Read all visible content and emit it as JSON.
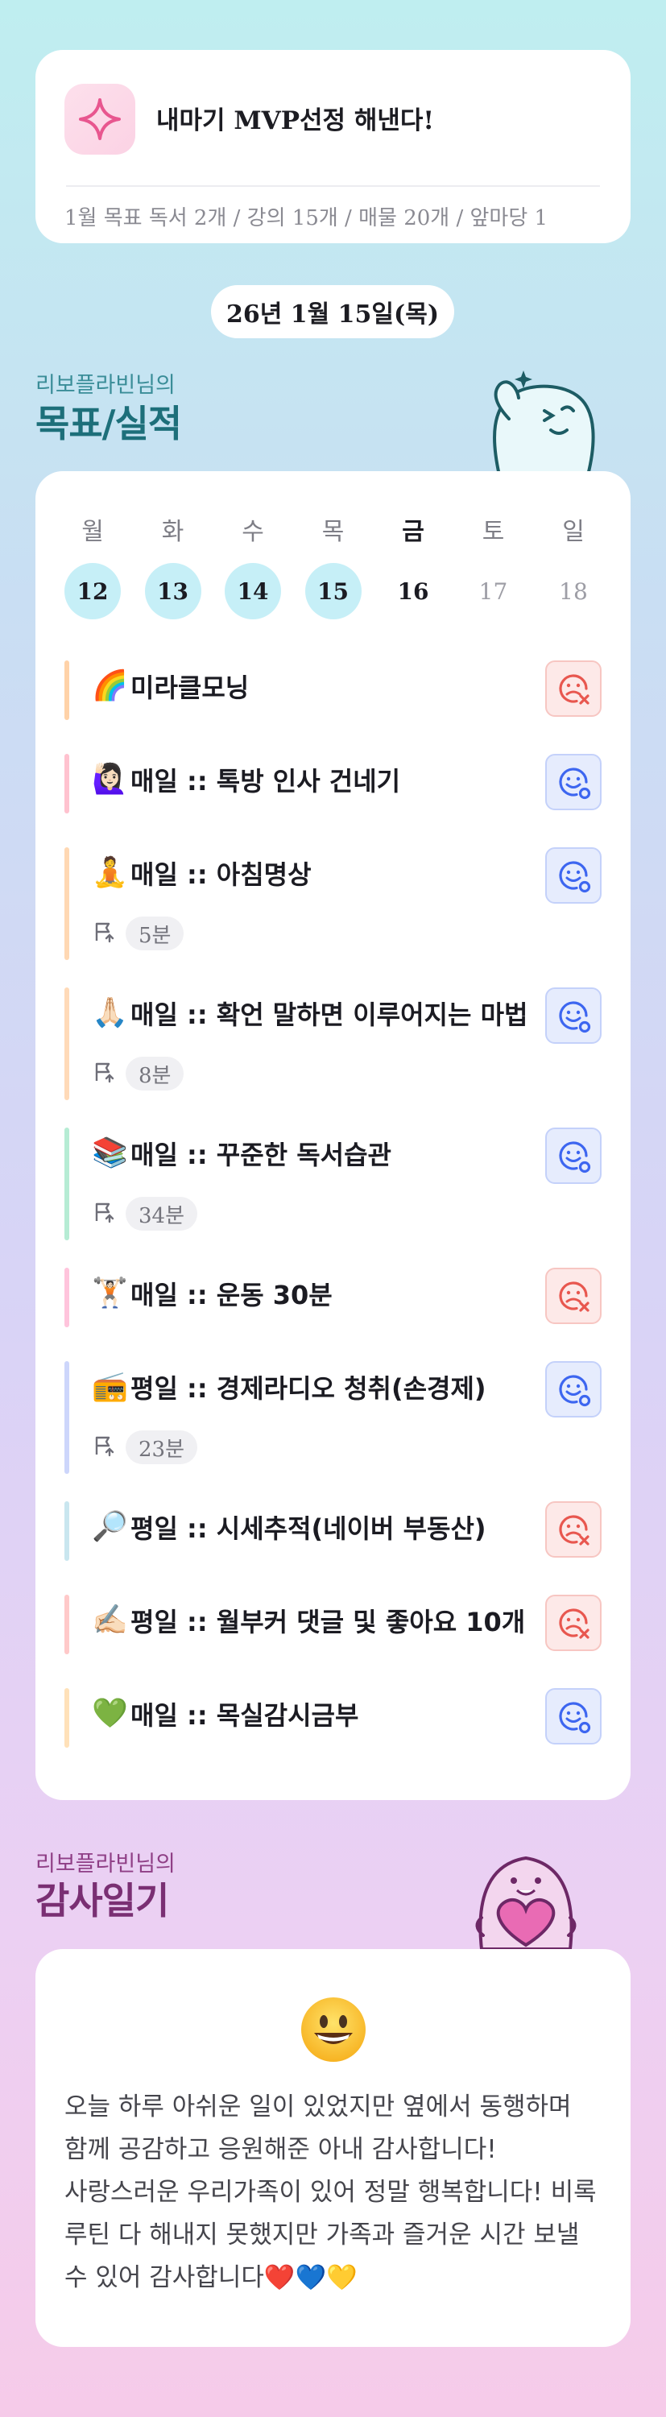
{
  "goal": {
    "title": "내마기 MVP선정 해낸다!",
    "subtitle": "1월 목표  독서 2개 / 강의 15개 / 매물 20개 / 앞마당 1",
    "icon": "sparkle-icon"
  },
  "date_label": "26년 1월 15일(목)",
  "goals_section": {
    "user_label": "리보플라빈님의",
    "title": "목표/실적"
  },
  "week": {
    "weekdays": [
      "월",
      "화",
      "수",
      "목",
      "금",
      "토",
      "일"
    ],
    "dates": [
      "12",
      "13",
      "14",
      "15",
      "16",
      "17",
      "18"
    ],
    "done_days": [
      true,
      true,
      true,
      true,
      false,
      false,
      false
    ],
    "today_index": 4
  },
  "habits": [
    {
      "emoji": "🌈",
      "title": "미라클모닝",
      "status": "fail",
      "bar_color": "#ffd2a8"
    },
    {
      "emoji": "🙋🏻‍♀️",
      "title": "매일 :: 톡방 인사 건네기",
      "status": "ok",
      "bar_color": "#ffc2cf"
    },
    {
      "emoji": "🧘",
      "title": "매일 :: 아침명상",
      "status": "ok",
      "duration": "5분",
      "bar_color": "#ffd8b3"
    },
    {
      "emoji": "🙏🏻",
      "title": "매일 :: 확언 말하면 이루어지는 마법",
      "status": "ok",
      "duration": "8분",
      "bar_color": "#ffdab8"
    },
    {
      "emoji": "📚",
      "title": "매일 :: 꾸준한 독서습관",
      "status": "ok",
      "duration": "34분",
      "bar_color": "#b6ecd4"
    },
    {
      "emoji": "🏋🏻",
      "title": "매일 :: 운동 30분",
      "status": "fail",
      "bar_color": "#ffc4dc"
    },
    {
      "emoji": "📻",
      "title": "평일 :: 경제라디오 청취(손경제)",
      "status": "ok",
      "duration": "23분",
      "bar_color": "#cdd6fb"
    },
    {
      "emoji": "🔎",
      "title": "평일 :: 시세추적(네이버 부동산)",
      "status": "fail",
      "bar_color": "#c9e6ef"
    },
    {
      "emoji": "✍🏻",
      "title": "평일 :: 월부커 댓글 및 좋아요 10개",
      "status": "fail",
      "bar_color": "#ffc9c9"
    },
    {
      "emoji": "💚",
      "title": "매일 :: 목실감시금부",
      "status": "ok",
      "bar_color": "#ffe1b9"
    }
  ],
  "thanks_section": {
    "user_label": "리보플라빈님의",
    "title": "감사일기"
  },
  "thanks": {
    "mood": "grinning-face",
    "text": "오늘 하루 아쉬운 일이 있었지만 옆에서 동행하며 함께 공감하고 응원해준 아내 감사합니다! 사랑스러운 우리가족이 있어 정말 행복합니다! 비록 루틴 다 해내지 못했지만 가족과 즐거운 시간 보낼 수 있어 감사합니다❤️💙💛"
  },
  "colors": {
    "fail_icon": "#e8574f",
    "ok_icon": "#3d66f0",
    "done_day_bg": "#c6eff7",
    "goals_title": "#1d6f7a",
    "thanks_title": "#7a2f73"
  }
}
